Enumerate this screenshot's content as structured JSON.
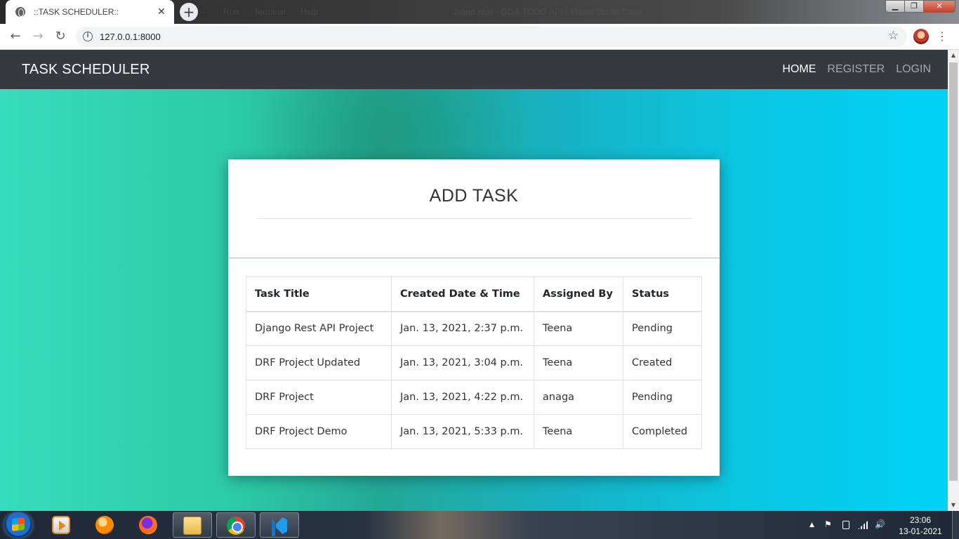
{
  "browser": {
    "tab_title": "::TASK SCHEDULER::",
    "tab_close": "✕",
    "new_tab": "+",
    "url": "127.0.0.1:8000",
    "info_icon": "i",
    "star_icon": "☆",
    "back_icon": "←",
    "forward_icon": "→",
    "reload_icon": "↻",
    "menu_icon": "⋮",
    "ghost_menu": "··· Run Terminal Help",
    "ghost_title": "Jsapp.html - GDA-TODO-API - Visual Studio Code",
    "window": {
      "minimize": "▁",
      "maximize": "❐",
      "close": "✕"
    }
  },
  "app": {
    "brand": "TASK SCHEDULER",
    "nav": [
      {
        "label": "HOME",
        "active": true
      },
      {
        "label": "REGISTER",
        "active": false
      },
      {
        "label": "LOGIN",
        "active": false
      }
    ]
  },
  "card": {
    "heading": "ADD TASK"
  },
  "table": {
    "headers": [
      "Task Title",
      "Created Date & Time",
      "Assigned By",
      "Status"
    ],
    "rows": [
      [
        "Django Rest API Project",
        "Jan. 13, 2021, 2:37 p.m.",
        "Teena",
        "Pending"
      ],
      [
        "DRF Project Updated",
        "Jan. 13, 2021, 3:04 p.m.",
        "Teena",
        "Created"
      ],
      [
        "DRF Project",
        "Jan. 13, 2021, 4:22 p.m.",
        "anaga",
        "Pending"
      ],
      [
        "DRF Project Demo",
        "Jan. 13, 2021, 5:33 p.m.",
        "Teena",
        "Completed"
      ]
    ]
  },
  "taskbar": {
    "time": "23:06",
    "date": "13-01-2021",
    "tray_arrow": "▲",
    "tray_flag": "⚑",
    "tray_volume": "🔊"
  },
  "colors": {
    "navbar_bg": "#343a40",
    "gradient_left": "#37dcbc",
    "gradient_right": "#00d2f6"
  }
}
